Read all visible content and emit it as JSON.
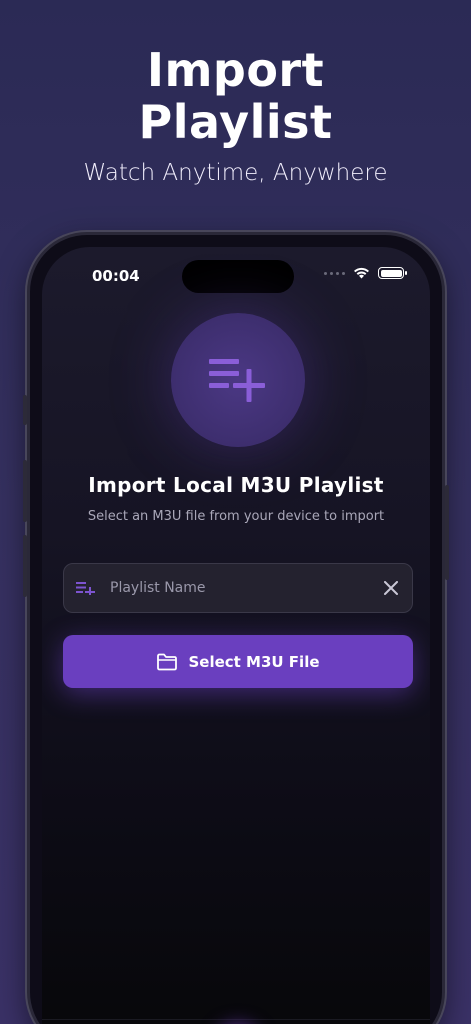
{
  "promo": {
    "title_line1": "Import",
    "title_line2": "Playlist",
    "subtitle": "Watch Anytime, Anywhere"
  },
  "status_bar": {
    "time": "00:04"
  },
  "import": {
    "title": "Import Local M3U Playlist",
    "description": "Select an M3U file from your device to import",
    "name_placeholder": "Playlist Name",
    "select_button_label": "Select M3U File",
    "hero_icon": "playlist-add-icon"
  },
  "tabbar": {
    "icons": [
      "home-icon",
      "link-icon",
      "add-icon",
      "speed-icon",
      "settings-icon"
    ]
  },
  "colors": {
    "accent": "#6a3fbf",
    "background": "#2b2a55"
  }
}
